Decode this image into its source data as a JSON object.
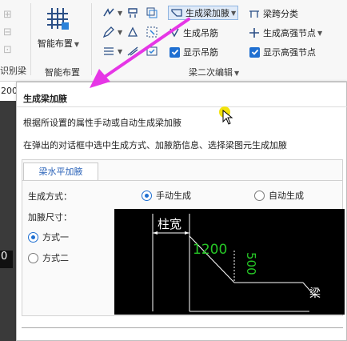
{
  "ribbon": {
    "left_label": "识别梁",
    "smart_layout": {
      "label": "智能布置",
      "group_label": "智能布置"
    },
    "tools": {
      "gen_haunch": "生成梁加腋",
      "span_class": "梁跨分类",
      "gen_hanger": "生成吊筋",
      "gen_strong_node": "生成高强节点",
      "show_hanger": "显示吊筋",
      "show_strong_node": "显示高强节点"
    },
    "group2_label": "梁二次编辑"
  },
  "left_strip": {
    "top_value": "200",
    "mid_value": "0"
  },
  "tooltip": {
    "title": "生成梁加腋",
    "desc1": "根据所设置的属性手动或自动生成梁加腋",
    "desc2": "在弹出的对话框中选中生成方式、加腋筋信息、选择梁图元生成加腋",
    "tab": "梁水平加腋",
    "gen_mode_label": "生成方式：",
    "manual": "手动生成",
    "auto": "自动生成",
    "size_label": "加腋尺寸：",
    "mode1": "方式一",
    "mode2": "方式二",
    "diagram": {
      "col_width": "柱宽",
      "dim1": "1200",
      "dim2": "500",
      "side_text": "梁"
    }
  },
  "colors": {
    "accent": "#1f6fd1",
    "annot_arrow": "#e636e6",
    "dim_green": "#26c726",
    "cursor_dot": "#f2e200"
  }
}
